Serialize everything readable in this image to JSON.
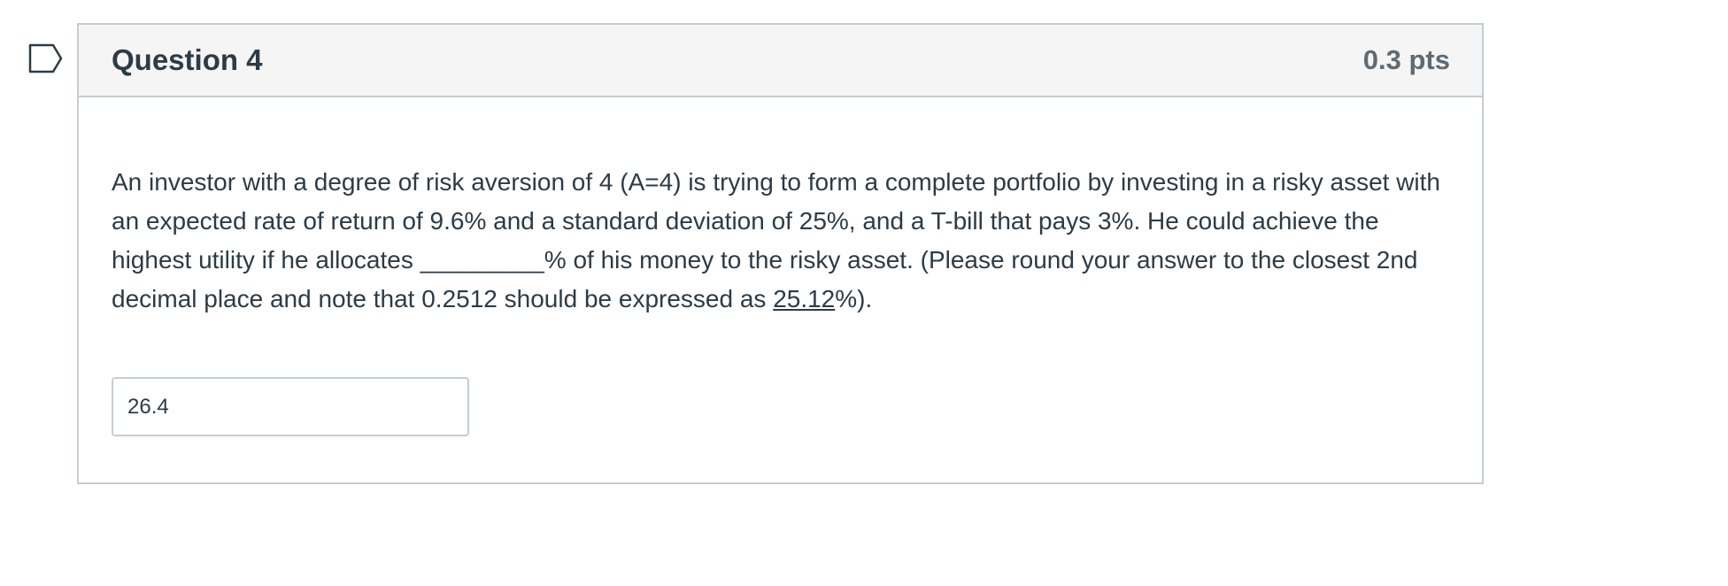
{
  "question": {
    "title": "Question 4",
    "points": "0.3 pts",
    "flag_icon": "bookmark-flag-icon",
    "text_part1": "An investor with a degree of risk aversion of 4 (A=4) is trying to form a complete portfolio by investing in a risky asset with an expected rate of return of 9.6% and a standard deviation of 25%, and a T-bill that pays 3%. He could achieve the highest utility if he allocates _________% of his money to the risky asset. (Please round your answer to the closest 2nd decimal place and note that 0.2512 should be expressed as ",
    "text_underlined": "25.12",
    "text_part2": "%).",
    "answer_value": "26.4"
  },
  "colors": {
    "border": "#c7cdd1",
    "header_bg": "#f5f5f5",
    "text": "#2d3b45",
    "flag": "#2d3b45"
  }
}
